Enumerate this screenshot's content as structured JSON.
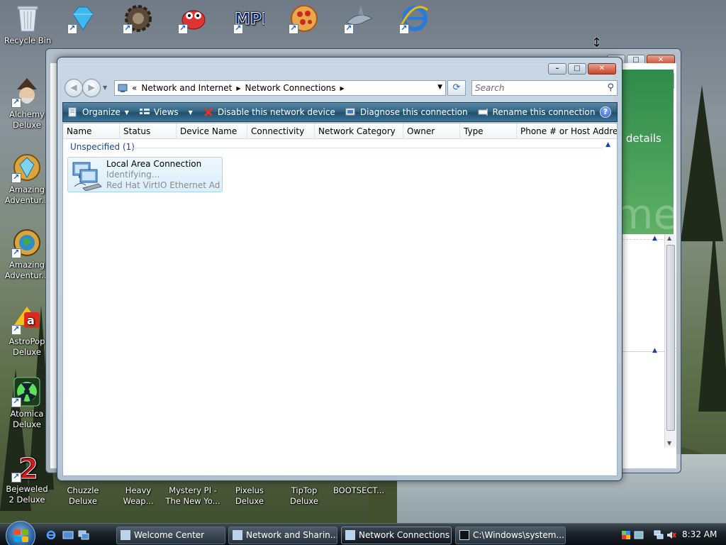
{
  "desktop": {
    "top_icons": [
      {
        "label": "Recycle Bin",
        "icon": "recycle-bin-icon"
      },
      {
        "label": "",
        "icon": "diamond-game-icon"
      },
      {
        "label": "",
        "icon": "gear-game-icon"
      },
      {
        "label": "",
        "icon": "bug-game-icon"
      },
      {
        "label": "",
        "icon": "mpi-game-icon"
      },
      {
        "label": "",
        "icon": "pizza-game-icon"
      },
      {
        "label": "",
        "icon": "shark-game-icon"
      },
      {
        "label": "",
        "icon": "internet-explorer-icon"
      }
    ],
    "left_icons": [
      {
        "label": "Alchemy Deluxe",
        "icon": "wizard-icon"
      },
      {
        "label": "Amazing Adventur...",
        "icon": "gem-compass-icon"
      },
      {
        "label": "Amazing Adventur...",
        "icon": "globe-compass-icon"
      },
      {
        "label": "AstroPop Deluxe",
        "icon": "astropop-icon"
      },
      {
        "label": "Atomica Deluxe",
        "icon": "radiation-icon"
      },
      {
        "label": "Bejeweled 2 Deluxe",
        "icon": "number-two-icon"
      }
    ],
    "bottom_icons": [
      {
        "label": "Chuzzle Deluxe"
      },
      {
        "label": "Heavy Weap..."
      },
      {
        "label": "Mystery PI - The New Yo..."
      },
      {
        "label": "Pixelus Deluxe"
      },
      {
        "label": "TipTop Deluxe"
      },
      {
        "label": "BOOTSECT..."
      }
    ]
  },
  "back_window": {
    "details_text": "re details",
    "watermark_text": "me"
  },
  "window": {
    "address": {
      "overflow": "«",
      "crumbs": [
        "Network and Internet",
        "Network Connections"
      ]
    },
    "search_placeholder": "Search",
    "toolbar": {
      "organize": "Organize",
      "views": "Views",
      "disable": "Disable this network device",
      "diagnose": "Diagnose this connection",
      "rename": "Rename this connection",
      "more": "»",
      "help": "?"
    },
    "columns": [
      "Name",
      "Status",
      "Device Name",
      "Connectivity",
      "Network Category",
      "Owner",
      "Type",
      "Phone # or Host Addre..."
    ],
    "group": {
      "label": "Unspecified (1)"
    },
    "item": {
      "name": "Local Area Connection",
      "status": "Identifying...",
      "device": "Red Hat VirtIO Ethernet Ada..."
    }
  },
  "taskbar": {
    "tasks": [
      {
        "label": "Welcome Center"
      },
      {
        "label": "Network and Sharin..."
      },
      {
        "label": "Network Connections"
      },
      {
        "label": "C:\\Windows\\system..."
      }
    ],
    "clock": "8:32 AM"
  },
  "colors": {
    "toolbar": "#2d5f80",
    "group_text": "#1e3f9a",
    "selection_border": "#a8d6f3"
  }
}
